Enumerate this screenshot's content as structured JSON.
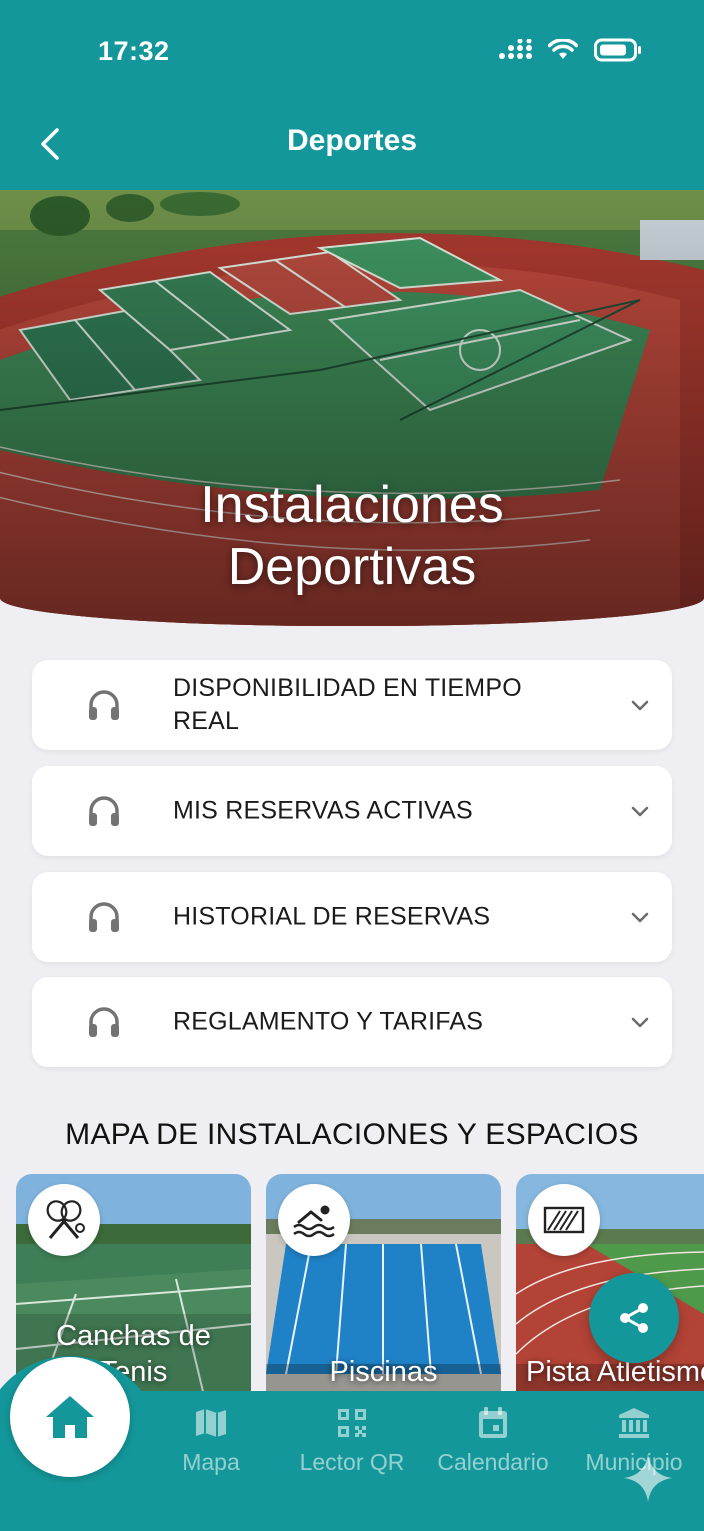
{
  "status_bar": {
    "time": "17:32"
  },
  "header": {
    "title": "Deportes",
    "back_icon": "chevron-left-icon"
  },
  "hero": {
    "title_line1": "Instalaciones",
    "title_line2": "Deportivas"
  },
  "accordion": [
    {
      "label": "DISPONIBILIDAD EN TIEMPO REAL",
      "icon": "headphones-icon"
    },
    {
      "label": "MIS RESERVAS ACTIVAS",
      "icon": "headphones-icon"
    },
    {
      "label": "HISTORIAL DE RESERVAS",
      "icon": "headphones-icon"
    },
    {
      "label": "REGLAMENTO Y TARIFAS",
      "icon": "headphones-icon"
    }
  ],
  "map_section": {
    "title": "MAPA DE INSTALACIONES Y ESPACIOS",
    "cards": [
      {
        "label_line1": "Canchas de",
        "label_line2": "Tenis",
        "icon": "tennis-rackets-icon"
      },
      {
        "label_line1": "Piscinas",
        "icon": "swimmer-icon"
      },
      {
        "label_line1": "Pista Atletismo",
        "icon": "running-track-icon"
      }
    ]
  },
  "share_button": {
    "icon": "share-icon"
  },
  "bottom_nav": {
    "items": [
      {
        "label": "Mapa",
        "icon": "map-icon"
      },
      {
        "label": "Lector QR",
        "icon": "qr-code-icon"
      },
      {
        "label": "Calendario",
        "icon": "calendar-icon"
      },
      {
        "label": "Municipio",
        "icon": "bank-icon"
      }
    ],
    "home_icon": "home-icon"
  },
  "colors": {
    "primary": "#14979a",
    "background": "#eeeef3",
    "track_red": "#b13c35",
    "court_green": "#3f8a5c"
  }
}
